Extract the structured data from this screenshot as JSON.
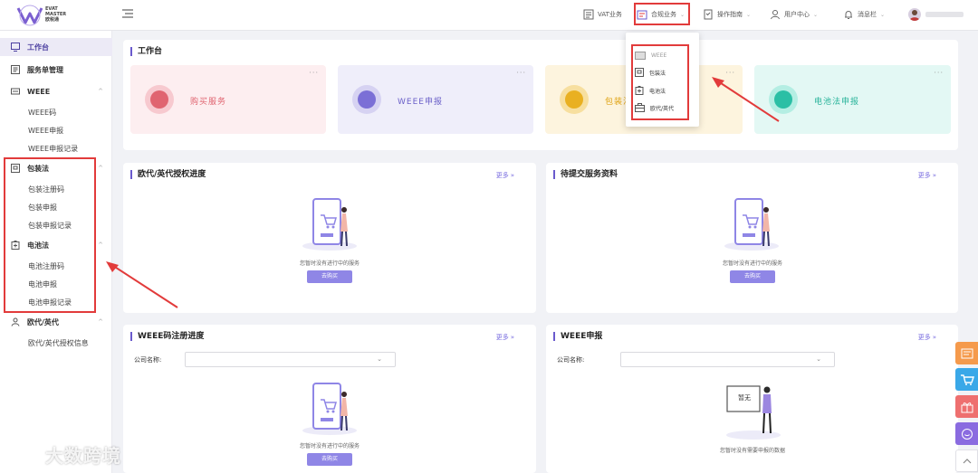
{
  "brand": {
    "name_line1": "EVAT",
    "name_line2": "MASTER",
    "name_cn": "欧税通"
  },
  "header": {
    "vat_business": "VAT业务",
    "compliance_business": "合规业务",
    "operation_guide": "操作指南",
    "user_center": "用户中心",
    "messages": "消息栏"
  },
  "compliance_dropdown": {
    "items": [
      {
        "label": "WEEE",
        "icon": "weee-icon"
      },
      {
        "label": "包装法",
        "icon": "packaging-icon"
      },
      {
        "label": "电池法",
        "icon": "battery-icon"
      },
      {
        "label": "欧代/英代",
        "icon": "briefcase-icon"
      }
    ]
  },
  "sidebar": {
    "workbench": "工作台",
    "service_orders": "服务单管理",
    "weee": {
      "label": "WEEE",
      "items": [
        "WEEE码",
        "WEEE申报",
        "WEEE申报记录"
      ]
    },
    "packaging": {
      "label": "包装法",
      "items": [
        "包装注册码",
        "包装申报",
        "包装申报记录"
      ]
    },
    "battery": {
      "label": "电池法",
      "items": [
        "电池注册码",
        "电池申报",
        "电池申报记录"
      ]
    },
    "eu_rep": {
      "label": "欧代/英代",
      "items": [
        "欧代/英代授权信息"
      ]
    }
  },
  "workbench": {
    "title": "工作台",
    "tiles": [
      {
        "label": "购买服务",
        "color": "#e06470"
      },
      {
        "label": "WEEE申报",
        "color": "#7b6fd6"
      },
      {
        "label": "包装法",
        "color": "#e9b021"
      },
      {
        "label": "电池法申报",
        "color": "#2bbfa5"
      }
    ],
    "tile_menu": "···"
  },
  "panels": {
    "eu_auth": {
      "title": "欧代/英代授权进度",
      "more": "更多",
      "empty_text": "您暂时没有进行中的服务",
      "button": "去购买"
    },
    "pending_docs": {
      "title": "待提交服务资料",
      "more": "更多",
      "empty_text": "您暂时没有进行中的服务",
      "button": "去购买"
    },
    "weee_progress": {
      "title": "WEEE码注册进度",
      "more": "更多",
      "company_label": "公司名称:",
      "company_value": "",
      "empty_text": "您暂时没有进行中的服务",
      "button": "去购买"
    },
    "weee_declare": {
      "title": "WEEE申报",
      "more": "更多",
      "company_label": "公司名称:",
      "company_value": "",
      "empty_text": "您暂时没有需要申报的数据",
      "board_text": "暂无"
    }
  },
  "watermark": "大数跨境"
}
